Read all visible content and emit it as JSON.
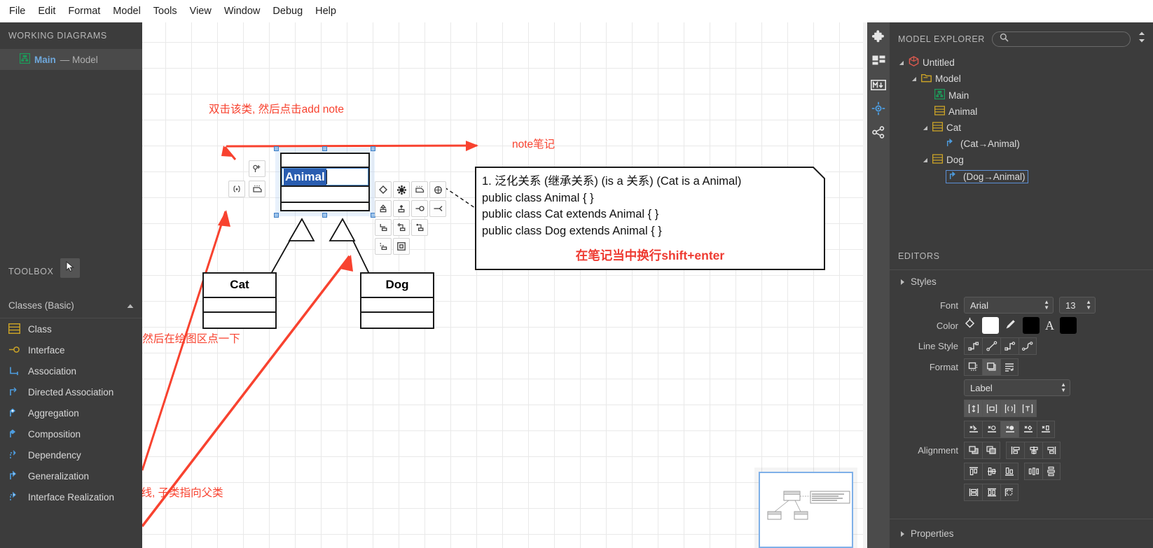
{
  "menubar": {
    "items": [
      "File",
      "Edit",
      "Format",
      "Model",
      "Tools",
      "View",
      "Window",
      "Debug",
      "Help"
    ]
  },
  "left_sidebar": {
    "working_diagrams": {
      "title": "WORKING DIAGRAMS",
      "items": [
        {
          "icon": "diagram-icon",
          "name": "Main",
          "suffix": "— Model"
        }
      ]
    },
    "toolbox": {
      "title": "TOOLBOX",
      "pointer_tool": "pointer-icon",
      "group_label": "Classes (Basic)",
      "group_collapse_icon": "chevron-up-icon",
      "tools": [
        {
          "label": "Class",
          "icon": "class-icon"
        },
        {
          "label": "Interface",
          "icon": "interface-icon"
        },
        {
          "label": "Association",
          "icon": "association-icon"
        },
        {
          "label": "Directed Association",
          "icon": "directed-association-icon"
        },
        {
          "label": "Aggregation",
          "icon": "aggregation-icon"
        },
        {
          "label": "Composition",
          "icon": "composition-icon"
        },
        {
          "label": "Dependency",
          "icon": "dependency-icon"
        },
        {
          "label": "Generalization",
          "icon": "generalization-icon"
        },
        {
          "label": "Interface Realization",
          "icon": "interface-realization-icon"
        }
      ]
    }
  },
  "canvas": {
    "classes": [
      {
        "name": "Animal",
        "selected": true,
        "editing": true
      },
      {
        "name": "Cat",
        "selected": false
      },
      {
        "name": "Dog",
        "selected": false
      }
    ],
    "note": {
      "lines": [
        "1. 泛化关系 (继承关系) (is a 关系) (Cat is a Animal)",
        "public class Animal { }",
        "public class Cat extends Animal { }",
        "public class Dog extends Animal { }"
      ],
      "red_note": "在笔记当中换行shift+enter"
    },
    "annotations": [
      {
        "id": "anno-add-note",
        "text": "双击该类, 然后点击add note"
      },
      {
        "id": "anno-note-label",
        "text": "note笔记"
      },
      {
        "id": "anno-class-tool",
        "text": "类, 点一下, 然后在绘图区点一下"
      },
      {
        "id": "anno-generalization",
        "text": "继承关系的线, 子类指向父类"
      }
    ],
    "quick_toolbar": {
      "buttons": [
        "add-attribute-icon",
        "add-operation-icon",
        "add-note-icon",
        "add-constraint-icon",
        "quick-edit-icon",
        "gear-icon",
        "add-note-shape-icon",
        "add-link-icon",
        "generalization-icon",
        "composition-icon",
        "interface-icon",
        "association-icon",
        "directed-association-icon",
        "aggregation-icon",
        "dependency-icon",
        "realization-icon",
        "subclass-icon"
      ]
    }
  },
  "icon_strip": {
    "items": [
      "extension-icon",
      "layout-icon",
      "markdown-icon",
      "target-icon",
      "share-icon"
    ]
  },
  "right_panel": {
    "model_explorer": {
      "title": "MODEL EXPLORER",
      "search_icon": "search-icon",
      "sort_icon": "sort-icon",
      "tree": [
        {
          "label": "Untitled",
          "depth": 0,
          "icon": "project-icon",
          "expander": "expanded",
          "selected": false
        },
        {
          "label": "Model",
          "depth": 1,
          "icon": "model-icon",
          "expander": "expanded",
          "selected": false
        },
        {
          "label": "Main",
          "depth": 2,
          "icon": "diagram-icon",
          "expander": "none",
          "selected": false
        },
        {
          "label": "Animal",
          "depth": 2,
          "icon": "class-icon",
          "expander": "none",
          "selected": false
        },
        {
          "label": "Cat",
          "depth": 2,
          "icon": "class-icon",
          "expander": "expanded",
          "selected": false
        },
        {
          "label": "(Cat→Animal)",
          "depth": 3,
          "icon": "generalization-icon",
          "expander": "none",
          "selected": false
        },
        {
          "label": "Dog",
          "depth": 2,
          "icon": "class-icon",
          "expander": "expanded",
          "selected": false
        },
        {
          "label": "(Dog→Animal)",
          "depth": 3,
          "icon": "generalization-icon",
          "expander": "none",
          "selected": true
        }
      ]
    },
    "editors": {
      "title": "EDITORS",
      "styles_label": "Styles",
      "font_label": "Font",
      "font_value": "Arial",
      "font_size_value": "13",
      "color_label": "Color",
      "color_fill": "#ffffff",
      "color_line": "#000000",
      "color_font": "#000000",
      "line_style_label": "Line Style",
      "line_style_icons": [
        "rectilinear-icon",
        "oblique-icon",
        "rounded-rect-icon",
        "curve-icon"
      ],
      "format_label": "Format",
      "format_icons": [
        "auto-resize-icon",
        "show-shadow-icon",
        "word-wrap-icon"
      ],
      "format_select_value": "Label",
      "label_visibility_icons": [
        "show-type-icon",
        "show-visibility-icon",
        "show-property-icon",
        "show-operation-icon"
      ],
      "suppress_icons": [
        "suppress-attributes-icon",
        "suppress-operations-icon",
        "suppress-receptions-icon",
        "suppress-literals-icon",
        "suppress-compartment-icon"
      ],
      "alignment_label": "Alignment",
      "alignment_icons_row1": [
        "send-to-back-icon",
        "bring-to-front-icon",
        "align-left-icon",
        "align-center-icon",
        "align-right-icon"
      ],
      "alignment_icons_row2": [
        "align-top-icon",
        "align-middle-icon",
        "align-bottom-icon",
        "space-horizontally-icon",
        "space-vertically-icon"
      ],
      "alignment_icons_row3": [
        "set-width-icon",
        "set-height-icon",
        "set-size-icon"
      ]
    },
    "properties": {
      "title": "Properties"
    }
  },
  "colors": {
    "panel_bg": "#3c3c3c",
    "accent_blue": "#6fa8dc",
    "annotation_red": "#f8422f",
    "selection_blue": "#2a5db0",
    "class_icon_yellow": "#c9a227",
    "link_icon_blue": "#4d9de0",
    "diagram_icon_green": "#1d9b5a"
  }
}
